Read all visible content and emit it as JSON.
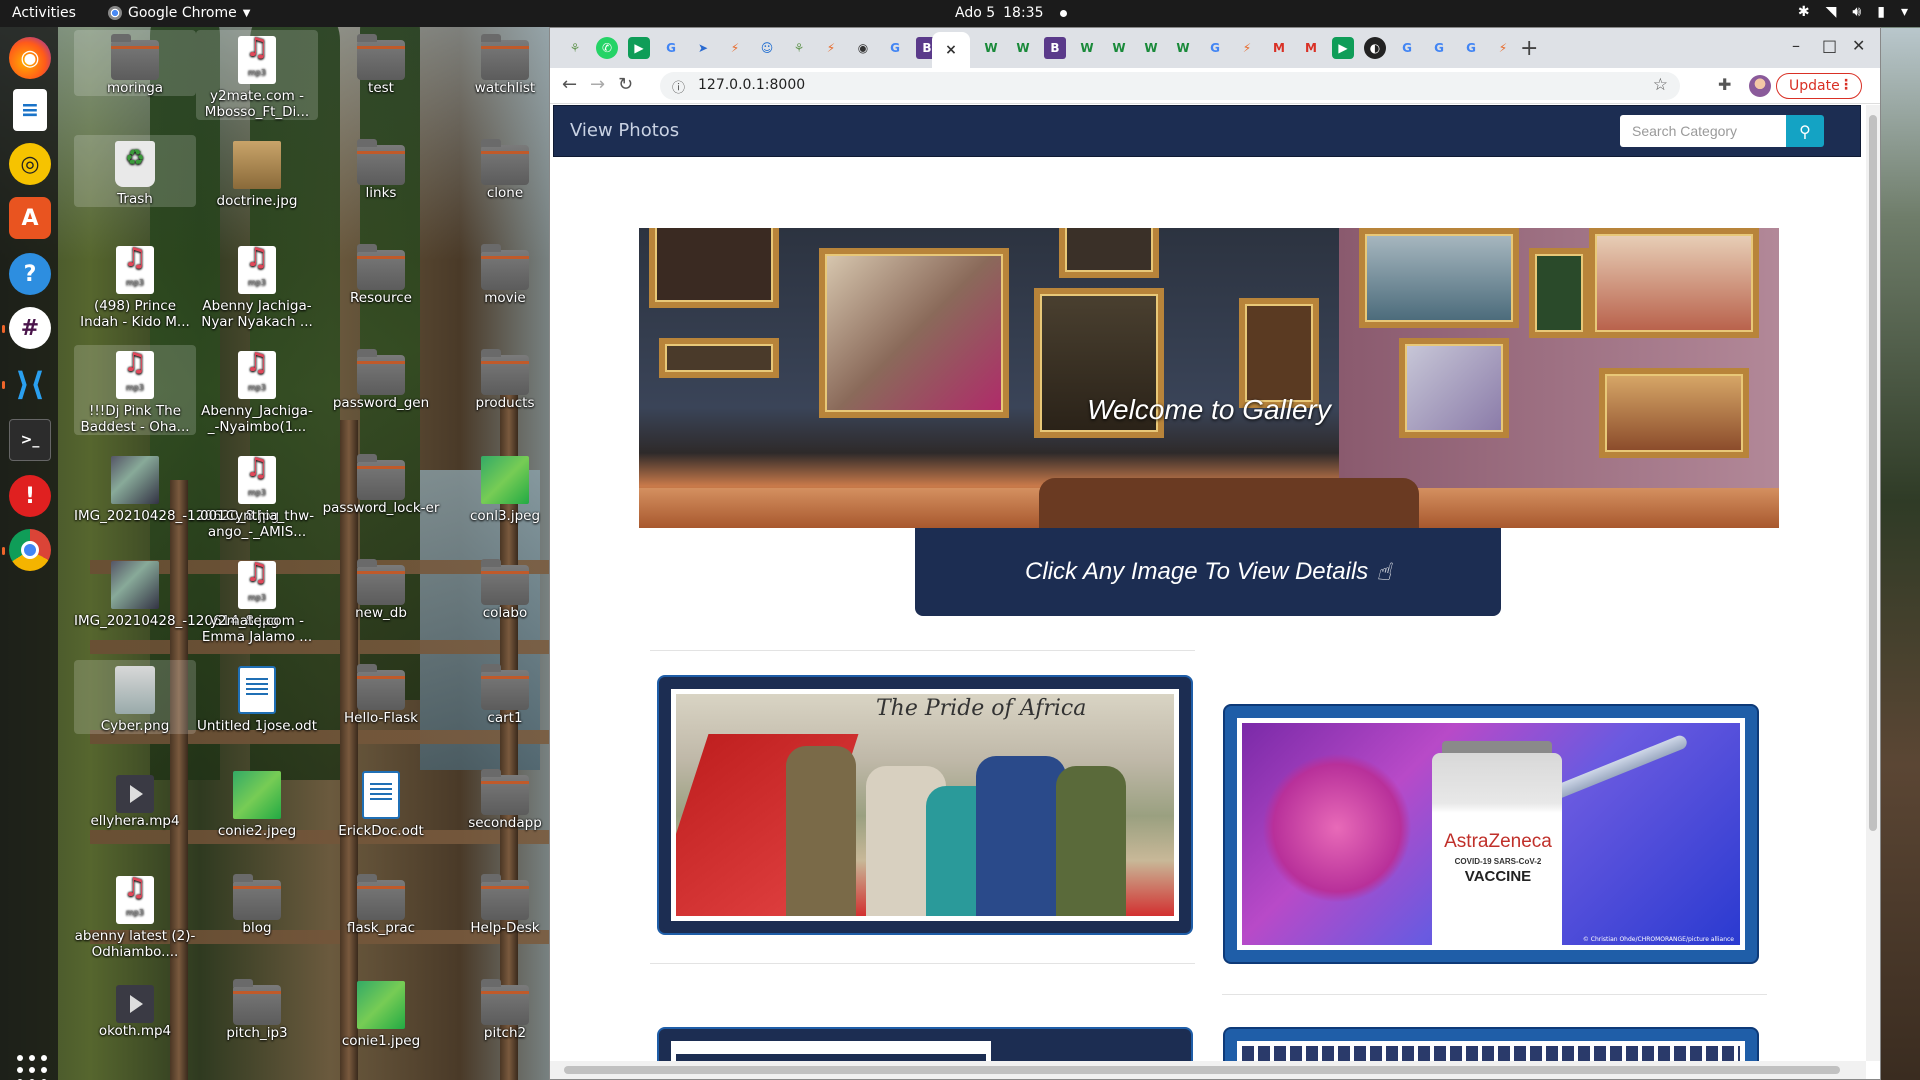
{
  "topbar": {
    "activities": "Activities",
    "app_name": "Google Chrome",
    "date": "Ado 5",
    "time": "18:35"
  },
  "dock": {
    "items": [
      "firefox-icon",
      "writer-icon",
      "rhythmbox-icon",
      "software-icon",
      "help-icon",
      "slack-icon",
      "vscode-icon",
      "terminal-icon",
      "alert-icon",
      "chrome-icon"
    ]
  },
  "desktop": {
    "icons": [
      {
        "label": "moringa",
        "type": "folder"
      },
      {
        "label": "y2mate.com - Mbosso_Ft_Di...",
        "type": "mp3"
      },
      {
        "label": "test",
        "type": "folder"
      },
      {
        "label": "watchlist",
        "type": "folder"
      },
      {
        "label": "Trash",
        "type": "trash"
      },
      {
        "label": "doctrine.jpg",
        "type": "image"
      },
      {
        "label": "links",
        "type": "folder"
      },
      {
        "label": "clone",
        "type": "folder"
      },
      {
        "label": "(498) Prince Indah - Kido M...",
        "type": "mp3"
      },
      {
        "label": "Abenny Jachiga- Nyar Nyakach ...",
        "type": "mp3"
      },
      {
        "label": "Resource",
        "type": "folder"
      },
      {
        "label": "movie",
        "type": "folder"
      },
      {
        "label": "!!!Dj Pink The Baddest - Oha...",
        "type": "mp3"
      },
      {
        "label": "Abenny_Jachiga-_-Nyaimbo(1...",
        "type": "mp3"
      },
      {
        "label": "password_gen",
        "type": "folder"
      },
      {
        "label": "products",
        "type": "folder"
      },
      {
        "label": "IMG_20210428_-120620_8.jpg",
        "type": "image"
      },
      {
        "label": "001Cynthia_thw-ango_-_AMIS...",
        "type": "mp3"
      },
      {
        "label": "password_lock-er",
        "type": "folder"
      },
      {
        "label": "conl3.jpeg",
        "type": "image"
      },
      {
        "label": "IMG_20210428_-120614_8.jpg",
        "type": "image"
      },
      {
        "label": "y2mate.com - Emma Jalamo ...",
        "type": "mp3"
      },
      {
        "label": "new_db",
        "type": "folder"
      },
      {
        "label": "colabo",
        "type": "folder"
      },
      {
        "label": "Cyber.png",
        "type": "image"
      },
      {
        "label": "Untitled 1jose.odt",
        "type": "odt"
      },
      {
        "label": "Hello-Flask",
        "type": "folder"
      },
      {
        "label": "cart1",
        "type": "folder"
      },
      {
        "label": "ellyhera.mp4",
        "type": "video"
      },
      {
        "label": "conie2.jpeg",
        "type": "image"
      },
      {
        "label": "ErickDoc.odt",
        "type": "odt"
      },
      {
        "label": "secondapp",
        "type": "folder"
      },
      {
        "label": "abenny latest (2)-Odhiambo....",
        "type": "mp3"
      },
      {
        "label": "blog",
        "type": "folder"
      },
      {
        "label": "flask_prac",
        "type": "folder"
      },
      {
        "label": "Help-Desk",
        "type": "folder"
      },
      {
        "label": "okoth.mp4",
        "type": "video"
      },
      {
        "label": "pitch_ip3",
        "type": "folder"
      },
      {
        "label": "conie1.jpeg",
        "type": "image"
      },
      {
        "label": "pitch2",
        "type": "folder"
      }
    ]
  },
  "browser": {
    "url": "127.0.0.1:8000",
    "update_label": "Update",
    "tab_close": "×",
    "new_tab": "+"
  },
  "page": {
    "brand": "View Photos",
    "search_placeholder": "Search Category",
    "hero_title": "Welcome to Gallery",
    "cta_text": "Click Any Image To View Details",
    "cards": [
      {
        "caption": "The Pride of Africa"
      },
      {
        "brand": "AstraZeneca",
        "subtitle": "COVID-19 SARS-CoV-2",
        "label": "VACCINE",
        "credit": "© Christian Ohde/CHROMORANGE/picture alliance"
      }
    ]
  }
}
